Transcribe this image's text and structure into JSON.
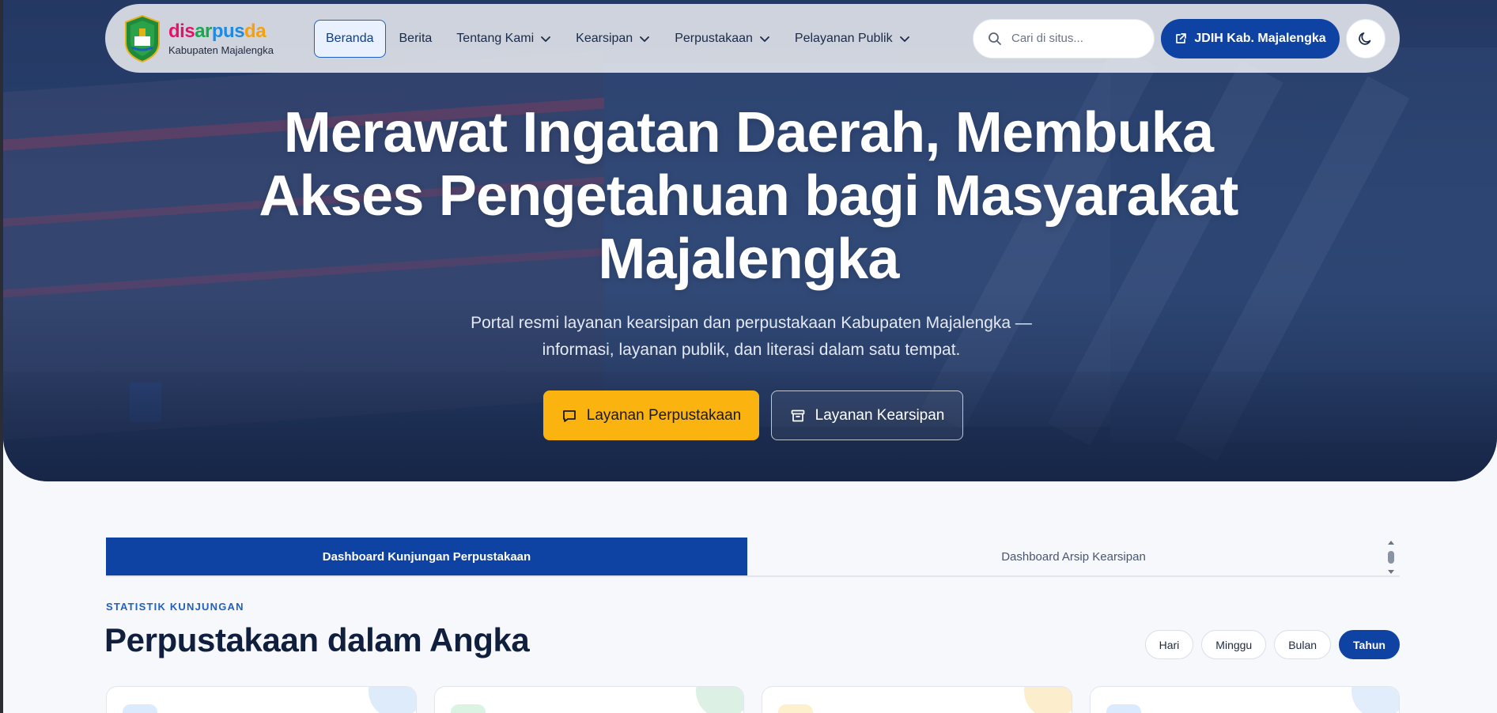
{
  "logo": {
    "brand_parts": [
      {
        "text": "dis",
        "color": "#e4136a"
      },
      {
        "text": "ar",
        "color": "#19a84d"
      },
      {
        "text": "pus",
        "color": "#1f8ae0"
      },
      {
        "text": "da",
        "color": "#f6a10c"
      }
    ],
    "subtitle": "Kabupaten Majalengka"
  },
  "nav": {
    "items": [
      {
        "label": "Beranda",
        "active": true,
        "dropdown": false
      },
      {
        "label": "Berita",
        "active": false,
        "dropdown": false
      },
      {
        "label": "Tentang Kami",
        "active": false,
        "dropdown": true
      },
      {
        "label": "Kearsipan",
        "active": false,
        "dropdown": true
      },
      {
        "label": "Perpustakaan",
        "active": false,
        "dropdown": true
      },
      {
        "label": "Pelayanan Publik",
        "active": false,
        "dropdown": true
      }
    ]
  },
  "search": {
    "placeholder": "Cari di situs...",
    "icon": "search-icon"
  },
  "header_actions": {
    "jdih_label": "JDIH Kab. Majalengka",
    "jdih_icon": "external-link-icon",
    "theme_icon": "moon-icon"
  },
  "hero": {
    "title": "Merawat Ingatan Daerah, Membuka Akses Pengetahuan bagi Masyarakat Majalengka",
    "subtitle": "Portal resmi layanan kearsipan dan perpustakaan Kabupaten Majalengka — informasi, layanan publik, dan literasi dalam satu tempat.",
    "primary_button": {
      "label": "Layanan Perpustakaan",
      "icon": "chat-icon"
    },
    "secondary_button": {
      "label": "Layanan Kearsipan",
      "icon": "archive-box-icon"
    }
  },
  "tabs": [
    {
      "label": "Dashboard Kunjungan Perpustakaan",
      "active": true
    },
    {
      "label": "Dashboard Arsip Kearsipan",
      "active": false
    }
  ],
  "section": {
    "overline": "STATISTIK KUNJUNGAN",
    "title": "Perpustakaan dalam Angka"
  },
  "period_filters": [
    {
      "label": "Hari",
      "active": false
    },
    {
      "label": "Minggu",
      "active": false
    },
    {
      "label": "Bulan",
      "active": false
    },
    {
      "label": "Tahun",
      "active": true
    }
  ],
  "colors": {
    "primary": "#0f43a3",
    "accent": "#fbb30f",
    "card_tints": [
      "#dbeafc",
      "#dbf3e2",
      "#fdf0cc",
      "#dbeafc"
    ],
    "card_blobs": [
      "#cfe3fa",
      "#cfe9d8",
      "#fbe6b8",
      "#d5e6fb"
    ]
  }
}
